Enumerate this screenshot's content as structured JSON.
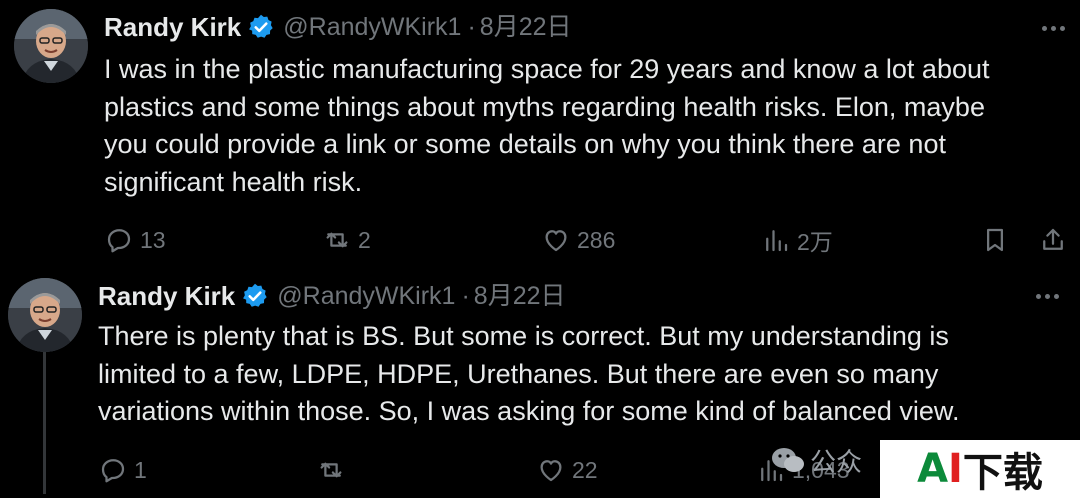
{
  "tweets": [
    {
      "author_name": "Randy Kirk",
      "handle": "@RandyWKirk1",
      "separator": "·",
      "date": "8月22日",
      "verified": true,
      "text": "I was in the plastic manufacturing space for 29 years and know a lot about\nplastics and some things about myths regarding health risks. Elon, maybe\nyou could provide a link or some details on why you think there are not\nsignificant health risk.",
      "replies": "13",
      "reposts": "2",
      "likes": "286",
      "views": "2万"
    },
    {
      "author_name": "Randy Kirk",
      "handle": "@RandyWKirk1",
      "separator": "·",
      "date": "8月22日",
      "verified": true,
      "text": "There is plenty that is BS. But some is correct. But my understanding is\nlimited to a few, LDPE, HDPE, Urethanes. But there are even so many\nvariations within those. So, I was asking for some kind of balanced view.",
      "replies": "1",
      "reposts": "",
      "likes": "22",
      "views": "1,043"
    }
  ],
  "colors": {
    "background": "#000000",
    "text": "#e7e9ea",
    "muted": "#71767b",
    "verified": "#1d9bf0"
  },
  "watermark": {
    "label_a": "A",
    "label_i": "I",
    "label_cn": "下载",
    "gzh": "公众"
  }
}
